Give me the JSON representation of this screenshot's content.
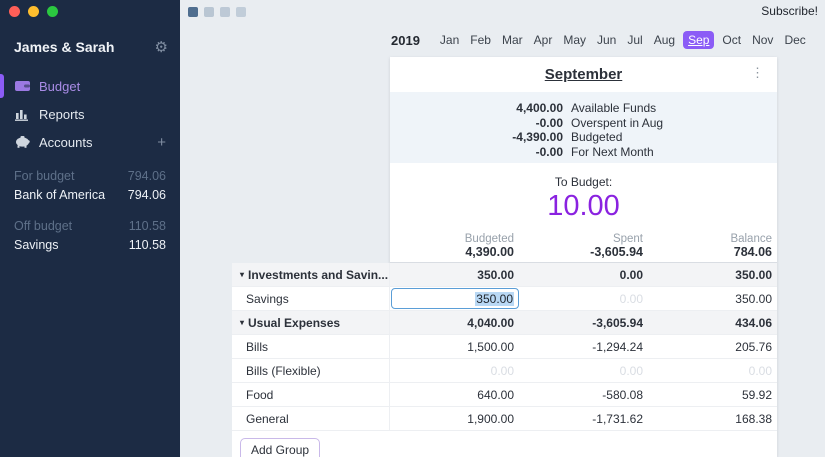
{
  "window": {
    "subscribe_label": "Subscribe!"
  },
  "icons": {
    "gear": "⚙",
    "plus": "+",
    "kebab": "⋮",
    "prev_arrow": "←",
    "next_arrow": "→",
    "group_triangle": "▾",
    "group_chevron": "⌄"
  },
  "colors": {
    "accent_purple": "#8b5cf6",
    "to_budget_purple": "#8a22e0",
    "input_blue": "#5b9ed7",
    "traffic": [
      "#ff5f58",
      "#ffbe2e",
      "#2bc840"
    ],
    "view_squares": [
      "#4f6e8f",
      "#b9c6d3",
      "#bdc9d6",
      "#c1cdd9"
    ]
  },
  "sidebar": {
    "title": "James & Sarah",
    "nav": [
      {
        "label": "Budget",
        "icon": "wallet-icon",
        "active": true
      },
      {
        "label": "Reports",
        "icon": "bar-chart-icon",
        "active": false
      },
      {
        "label": "Accounts",
        "icon": "piggy-bank-icon",
        "active": false,
        "has_add": true
      }
    ],
    "account_groups": [
      {
        "header": {
          "label": "For budget",
          "value": "794.06"
        },
        "accounts": [
          {
            "label": "Bank of America",
            "value": "794.06"
          }
        ]
      },
      {
        "header": {
          "label": "Off budget",
          "value": "110.58"
        },
        "accounts": [
          {
            "label": "Savings",
            "value": "110.58"
          }
        ]
      }
    ]
  },
  "monthbar": {
    "year": "2019",
    "months": [
      "Jan",
      "Feb",
      "Mar",
      "Apr",
      "May",
      "Jun",
      "Jul",
      "Aug",
      "Sep",
      "Oct",
      "Nov",
      "Dec"
    ],
    "active_month": "Sep"
  },
  "budget": {
    "month_title": "September",
    "summary": [
      {
        "amount": "4,400.00",
        "label": "Available Funds"
      },
      {
        "amount": "-0.00",
        "label": "Overspent in Aug"
      },
      {
        "amount": "-4,390.00",
        "label": "Budgeted"
      },
      {
        "amount": "-0.00",
        "label": "For Next Month"
      }
    ],
    "to_budget": {
      "label": "To Budget:",
      "amount": "10.00"
    },
    "totals": {
      "budgeted_label": "Budgeted",
      "budgeted": "4,390.00",
      "spent_label": "Spent",
      "spent": "-3,605.94",
      "balance_label": "Balance",
      "balance": "784.06"
    },
    "rows": [
      {
        "type": "group",
        "name": "Investments and Savin...",
        "has_chevron": true,
        "budgeted": "350.00",
        "spent": "0.00",
        "balance": "350.00"
      },
      {
        "type": "category",
        "name": "Savings",
        "editing": true,
        "budgeted": "350.00",
        "spent": "0.00",
        "balance": "350.00",
        "spent_faded": true
      },
      {
        "type": "group",
        "name": "Usual Expenses",
        "budgeted": "4,040.00",
        "spent": "-3,605.94",
        "balance": "434.06"
      },
      {
        "type": "category",
        "name": "Bills",
        "budgeted": "1,500.00",
        "spent": "-1,294.24",
        "balance": "205.76"
      },
      {
        "type": "category",
        "name": "Bills (Flexible)",
        "all_faded": true,
        "budgeted": "0.00",
        "spent": "0.00",
        "balance": "0.00"
      },
      {
        "type": "category",
        "name": "Food",
        "budgeted": "640.00",
        "spent": "-580.08",
        "balance": "59.92"
      },
      {
        "type": "category",
        "name": "General",
        "budgeted": "1,900.00",
        "spent": "-1,731.62",
        "balance": "168.38"
      }
    ],
    "add_group_label": "Add Group"
  }
}
